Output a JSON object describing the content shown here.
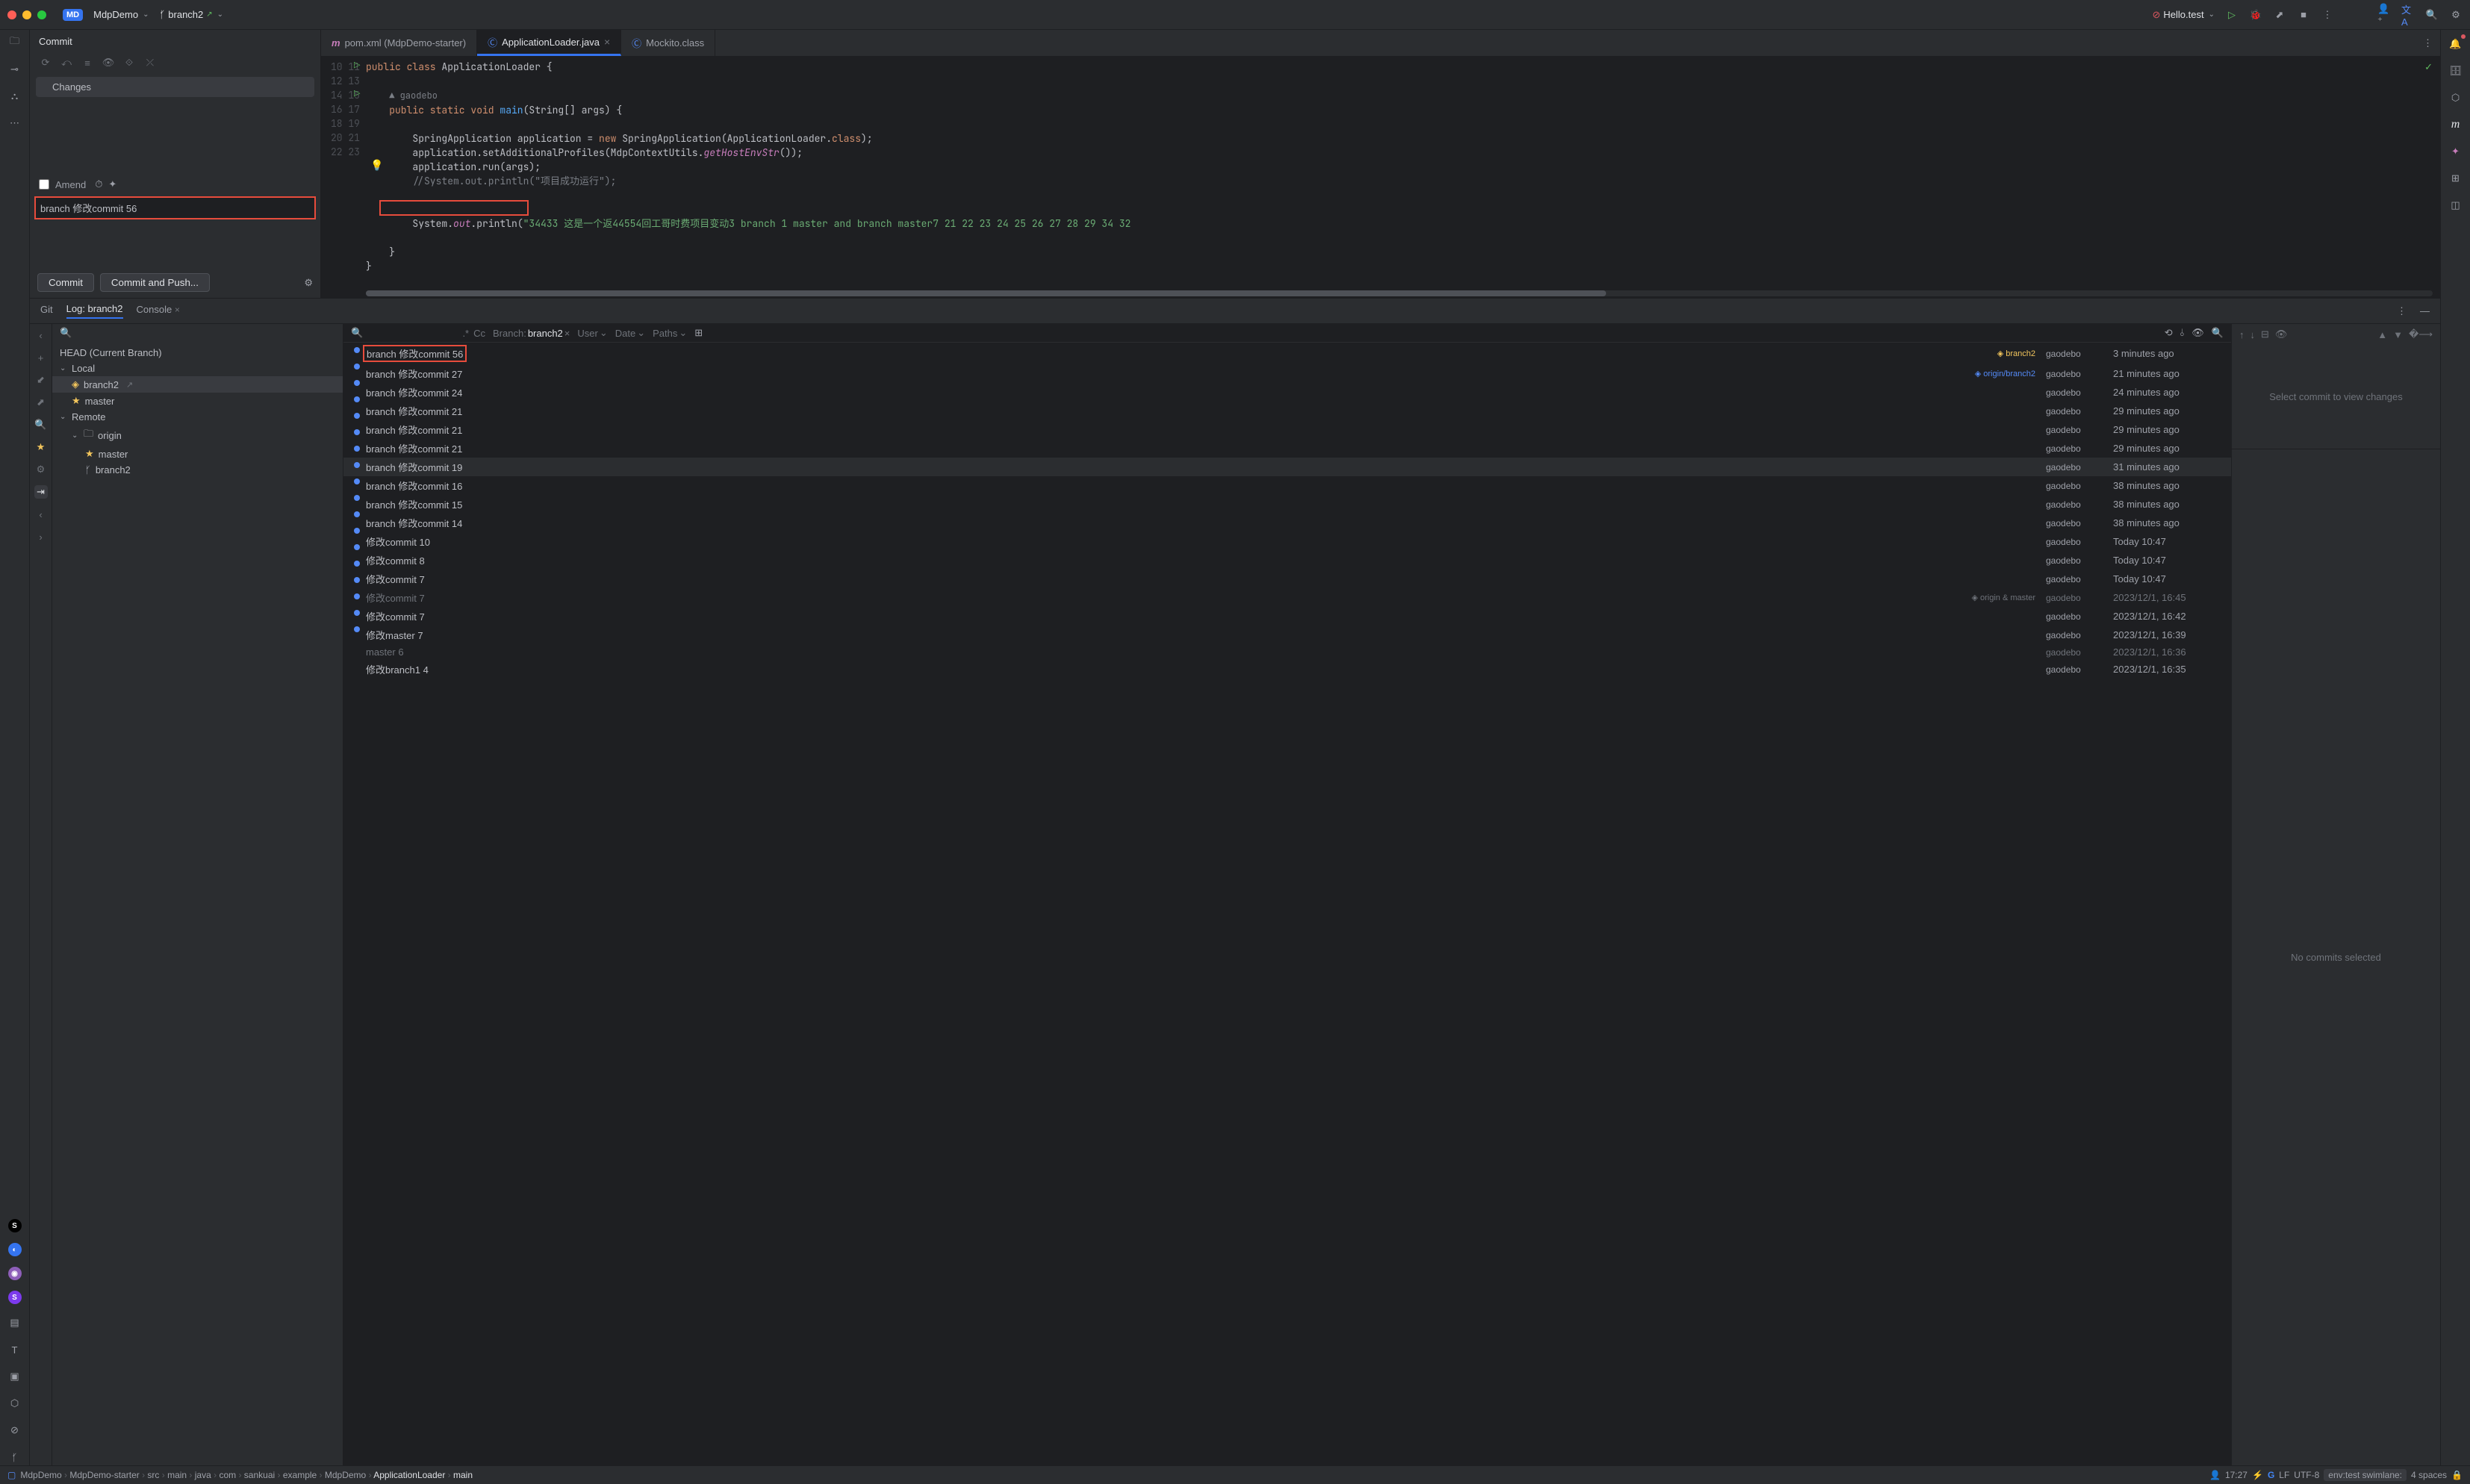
{
  "titlebar": {
    "project": "MdpDemo",
    "branch": "branch2",
    "run_config": "Hello.test"
  },
  "commit_panel": {
    "title": "Commit",
    "changes_label": "Changes",
    "amend_label": "Amend",
    "message": "branch 修改commit 56",
    "commit_btn": "Commit",
    "commit_push_btn": "Commit and Push..."
  },
  "editor": {
    "tabs": [
      {
        "label": "pom.xml (MdpDemo-starter)",
        "icon": "m",
        "active": false
      },
      {
        "label": "ApplicationLoader.java",
        "icon": "c",
        "active": true,
        "closable": true
      },
      {
        "label": "Mockito.class",
        "icon": "c",
        "active": false
      }
    ],
    "gutter_start": 10,
    "author_hint": "gaodebo",
    "lines": {
      "l10": {
        "pre": "",
        "kw1": "public class",
        "cls": " ApplicationLoader {"
      },
      "l12": {
        "pre": "    ",
        "kw": "public static void ",
        "fn": "main",
        "rest": "(String[] args) {"
      },
      "l14": {
        "pre": "        ",
        "a": "SpringApplication application = ",
        "kw": "new",
        "b": " SpringApplication(ApplicationLoader.",
        "kw2": "class",
        "c": ");"
      },
      "l15": {
        "pre": "        ",
        "a": "application.setAdditionalProfiles(MdpContextUtils.",
        "i": "getHostEnvStr",
        "b": "());"
      },
      "l16": "        application.run(args);",
      "l17": "        //System.out.println(\"项目成功运行\");",
      "l20": {
        "pre": "        ",
        "a": "System.",
        "f": "out",
        "b": ".println(",
        "s": "\"34433 这是一个返44554回工哥时费项目变动3 branch 1 master and branch master7 21 22 23 24 25 26 27 28 29 34 32 ",
        "c": ""
      },
      "l22": "    }",
      "l23": "}"
    }
  },
  "lower": {
    "tabs": {
      "git": "Git",
      "log": "Log: branch2",
      "console": "Console"
    },
    "branch_head": "HEAD (Current Branch)",
    "local": "Local",
    "remote": "Remote",
    "origin": "origin",
    "branches": {
      "b2": "branch2",
      "master": "master"
    },
    "filter": {
      "regex": ".*",
      "cc": "Cc",
      "branch_lbl": "Branch:",
      "branch_val": "branch2",
      "user": "User",
      "date": "Date",
      "paths": "Paths"
    },
    "commits": [
      {
        "msg": "branch 修改commit 56",
        "badge": "branch2",
        "badge_cls": "y",
        "author": "gaodebo",
        "time": "3 minutes ago",
        "red": true
      },
      {
        "msg": "branch 修改commit 27",
        "badge": "origin/branch2",
        "badge_cls": "b",
        "author": "gaodebo",
        "time": "21 minutes ago"
      },
      {
        "msg": "branch 修改commit 24",
        "author": "gaodebo",
        "time": "24 minutes ago"
      },
      {
        "msg": "branch 修改commit 21",
        "author": "gaodebo",
        "time": "29 minutes ago"
      },
      {
        "msg": "branch 修改commit 21",
        "author": "gaodebo",
        "time": "29 minutes ago"
      },
      {
        "msg": "branch 修改commit 21",
        "author": "gaodebo",
        "time": "29 minutes ago"
      },
      {
        "msg": "branch 修改commit 19",
        "author": "gaodebo",
        "time": "31 minutes ago",
        "sel": true
      },
      {
        "msg": "branch 修改commit 16",
        "author": "gaodebo",
        "time": "38 minutes ago"
      },
      {
        "msg": "branch 修改commit 15",
        "author": "gaodebo",
        "time": "38 minutes ago"
      },
      {
        "msg": "branch 修改commit 14",
        "author": "gaodebo",
        "time": "38 minutes ago"
      },
      {
        "msg": "修改commit 10",
        "author": "gaodebo",
        "time": "Today 10:47"
      },
      {
        "msg": "修改commit 8",
        "author": "gaodebo",
        "time": "Today 10:47"
      },
      {
        "msg": "修改commit 7",
        "author": "gaodebo",
        "time": "Today 10:47"
      },
      {
        "msg": "修改commit 7",
        "badge": "origin & master",
        "badge_cls": "g",
        "author": "gaodebo",
        "time": "2023/12/1, 16:45",
        "dim": true
      },
      {
        "msg": "修改commit 7",
        "author": "gaodebo",
        "time": "2023/12/1, 16:42"
      },
      {
        "msg": "修改master 7",
        "author": "gaodebo",
        "time": "2023/12/1, 16:39"
      },
      {
        "msg": "master 6",
        "author": "gaodebo",
        "time": "2023/12/1, 16:36",
        "dim": true
      },
      {
        "msg": "修改branch1 4",
        "author": "gaodebo",
        "time": "2023/12/1, 16:35"
      }
    ],
    "detail": {
      "msg1": "Select commit to view changes",
      "msg2": "No commits selected"
    }
  },
  "crumbs": {
    "items": [
      "MdpDemo",
      "MdpDemo-starter",
      "src",
      "main",
      "java",
      "com",
      "sankuai",
      "example",
      "MdpDemo",
      "ApplicationLoader",
      "main"
    ],
    "time": "17:27",
    "lf": "LF",
    "enc": "UTF-8",
    "env": "env:test swimlane:",
    "spaces": "4 spaces"
  }
}
